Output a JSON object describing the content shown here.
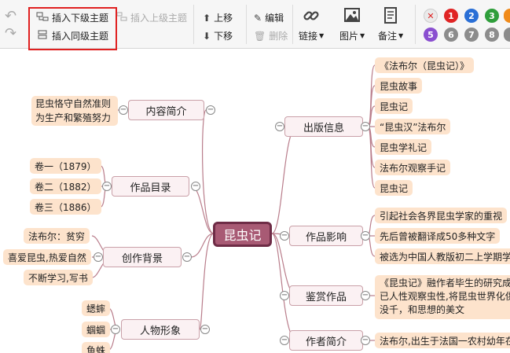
{
  "toolbar": {
    "insert_child": "插入下级主题",
    "insert_parent": "插入上级主题",
    "insert_sibling": "插入同级主题",
    "move_up": "上移",
    "move_down": "下移",
    "edit": "编辑",
    "delete": "删除",
    "link": "链接",
    "image": "图片",
    "note": "备注",
    "priorities": [
      "1",
      "2",
      "3",
      "5",
      "6",
      "7",
      "8"
    ],
    "colors": {
      "highlight": "#e02020",
      "p1": "#e02424",
      "p2": "#2a6fd6",
      "p3": "#2e9e3a",
      "p5": "#8a4fd0",
      "grey": "#8c8c8c"
    }
  },
  "mindmap": {
    "central": "昆虫记",
    "topics": {
      "publish": "出版信息",
      "impact": "作品影响",
      "appreciation": "鉴赏作品",
      "author": "作者简介",
      "intro": "内容简介",
      "catalog": "作品目录",
      "background": "创作背景",
      "characters": "人物形象"
    },
    "publish_leaves": [
      "《法布尔（昆虫记）》",
      "昆虫故事",
      "昆虫记",
      "“昆虫汉”法布尔",
      "昆虫学礼记",
      "法布尔观察手记",
      "昆虫记"
    ],
    "impact_leaves": [
      "引起社会各界昆虫学家的重视",
      "先后曾被翻译成50多种文字",
      "被选为中国人教版初二上学期学"
    ],
    "appreciation_leaves": [
      "《昆虫记》融作者毕生的研究成",
      "已人性观察虫性,将昆虫世界化供",
      "没千，和思想的美文"
    ],
    "author_leaves": [
      "法布尔,出生于法国一农村幼年在"
    ],
    "intro_leaves": [
      "昆虫恪守自然准则",
      "为生产和繁殖努力"
    ],
    "catalog_leaves": [
      "卷一（1879）",
      "卷二（1882）",
      "卷三（1886）"
    ],
    "background_leaves": [
      "法布尔：贫穷",
      "喜爱昆虫,热爱自然",
      "不断学习,写书"
    ],
    "character_leaves": [
      "蟋蟀",
      "蝈蝈",
      "鱼蛛"
    ]
  }
}
